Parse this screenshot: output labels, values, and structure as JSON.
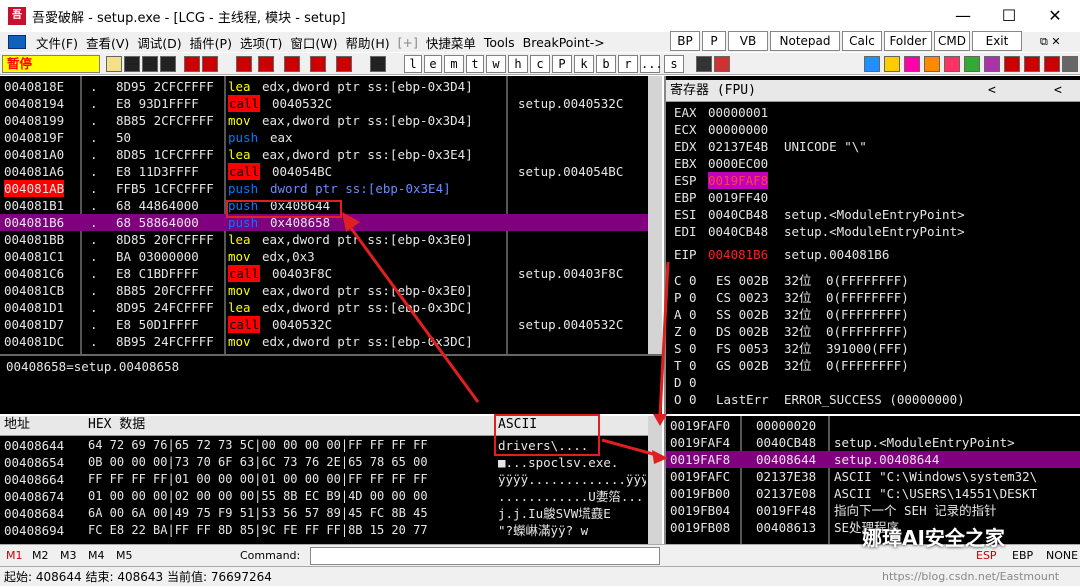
{
  "window": {
    "title": "吾愛破解 - setup.exe - [LCG - 主线程, 模块 - setup]",
    "app_icon_text": "吾",
    "minimize": "—",
    "maximize": "☐",
    "close": "✕"
  },
  "menu": {
    "items": [
      "文件(F)",
      "查看(V)",
      "调试(D)",
      "插件(P)",
      "选项(T)",
      "窗口(W)",
      "帮助(H)",
      "[+]",
      "快捷菜单",
      "Tools",
      "BreakPoint->"
    ],
    "quick_buttons": [
      "BP",
      "P",
      "VB",
      "Notepad",
      "Calc",
      "Folder",
      "CMD",
      "Exit"
    ]
  },
  "toolbar": {
    "status": "暂停",
    "letters": [
      "l",
      "e",
      "m",
      "t",
      "w",
      "h",
      "c",
      "P",
      "k",
      "b",
      "r",
      "...",
      "s"
    ]
  },
  "disasm": {
    "rows": [
      {
        "addr": "0040818E",
        "dot": ".",
        "hex": "8D95 2CFCFFFF",
        "op": "lea",
        "args": "edx,dword ptr ss:[ebp-0x3D4]",
        "comment": ""
      },
      {
        "addr": "00408194",
        "dot": ".",
        "hex": "E8 93D1FFFF",
        "op": "call",
        "args": "0040532C",
        "comment": "setup.0040532C"
      },
      {
        "addr": "00408199",
        "dot": ".",
        "hex": "8B85 2CFCFFFF",
        "op": "mov",
        "args": "eax,dword ptr ss:[ebp-0x3D4]",
        "comment": ""
      },
      {
        "addr": "0040819F",
        "dot": ".",
        "hex": "50",
        "op": "push",
        "args": "eax",
        "comment": ""
      },
      {
        "addr": "004081A0",
        "dot": ".",
        "hex": "8D85 1CFCFFFF",
        "op": "lea",
        "args": "eax,dword ptr ss:[ebp-0x3E4]",
        "comment": ""
      },
      {
        "addr": "004081A6",
        "dot": ".",
        "hex": "E8 11D3FFFF",
        "op": "call",
        "args": "004054BC",
        "comment": "setup.004054BC"
      },
      {
        "addr": "004081AB",
        "dot": ".",
        "hex": "FFB5 1CFCFFFF",
        "op": "push",
        "args": "dword ptr ss:[ebp-0x3E4]",
        "comment": ""
      },
      {
        "addr": "004081B1",
        "dot": ".",
        "hex": "68 44864000",
        "op": "push",
        "args": "0x408644",
        "comment": ""
      },
      {
        "addr": "004081B6",
        "dot": ".",
        "hex": "68 58864000",
        "op": "push",
        "args": "0x408658",
        "comment": ""
      },
      {
        "addr": "004081BB",
        "dot": ".",
        "hex": "8D85 20FCFFFF",
        "op": "lea",
        "args": "eax,dword ptr ss:[ebp-0x3E0]",
        "comment": ""
      },
      {
        "addr": "004081C1",
        "dot": ".",
        "hex": "BA 03000000",
        "op": "mov",
        "args": "edx,0x3",
        "comment": ""
      },
      {
        "addr": "004081C6",
        "dot": ".",
        "hex": "E8 C1BDFFFF",
        "op": "call",
        "args": "00403F8C",
        "comment": "setup.00403F8C"
      },
      {
        "addr": "004081CB",
        "dot": ".",
        "hex": "8B85 20FCFFFF",
        "op": "mov",
        "args": "eax,dword ptr ss:[ebp-0x3E0]",
        "comment": ""
      },
      {
        "addr": "004081D1",
        "dot": ".",
        "hex": "8D95 24FCFFFF",
        "op": "lea",
        "args": "edx,dword ptr ss:[ebp-0x3DC]",
        "comment": ""
      },
      {
        "addr": "004081D7",
        "dot": ".",
        "hex": "E8 50D1FFFF",
        "op": "call",
        "args": "0040532C",
        "comment": "setup.0040532C"
      },
      {
        "addr": "004081DC",
        "dot": ".",
        "hex": "8B95 24FCFFFF",
        "op": "mov",
        "args": "edx,dword ptr ss:[ebp-0x3DC]",
        "comment": ""
      }
    ],
    "info_line": "00408658=setup.00408658"
  },
  "registers": {
    "header": "寄存器 (FPU)",
    "general": [
      {
        "name": "EAX",
        "value": "00000001",
        "note": ""
      },
      {
        "name": "ECX",
        "value": "00000000",
        "note": ""
      },
      {
        "name": "EDX",
        "value": "02137E4B",
        "note": "UNICODE \"\\\""
      },
      {
        "name": "EBX",
        "value": "0000EC00",
        "note": ""
      },
      {
        "name": "ESP",
        "value": "0019FAF8",
        "note": ""
      },
      {
        "name": "EBP",
        "value": "0019FF40",
        "note": ""
      },
      {
        "name": "ESI",
        "value": "0040CB48",
        "note": "setup.<ModuleEntryPoint>"
      },
      {
        "name": "EDI",
        "value": "0040CB48",
        "note": "setup.<ModuleEntryPoint>"
      }
    ],
    "eip": {
      "name": "EIP",
      "value": "004081B6",
      "note": "setup.004081B6"
    },
    "segments": [
      {
        "flag": "C 0",
        "seg": "ES 002B",
        "bits": "32位",
        "limit": "0(FFFFFFFF)"
      },
      {
        "flag": "P 0",
        "seg": "CS 0023",
        "bits": "32位",
        "limit": "0(FFFFFFFF)"
      },
      {
        "flag": "A 0",
        "seg": "SS 002B",
        "bits": "32位",
        "limit": "0(FFFFFFFF)"
      },
      {
        "flag": "Z 0",
        "seg": "DS 002B",
        "bits": "32位",
        "limit": "0(FFFFFFFF)"
      },
      {
        "flag": "S 0",
        "seg": "FS 0053",
        "bits": "32位",
        "limit": "391000(FFF)"
      },
      {
        "flag": "T 0",
        "seg": "GS 002B",
        "bits": "32位",
        "limit": "0(FFFFFFFF)"
      },
      {
        "flag": "D 0",
        "seg": "",
        "bits": "",
        "limit": ""
      },
      {
        "flag": "O 0",
        "seg": "LastErr",
        "bits": "",
        "limit": "ERROR_SUCCESS (00000000)"
      }
    ]
  },
  "dump": {
    "col_addr": "地址",
    "col_hex": "HEX 数据",
    "col_ascii": "ASCII",
    "rows": [
      {
        "addr": "00408644",
        "hex": "64 72 69 76|65 72 73 5C|00 00 00 00|FF FF FF FF",
        "ascii": "drivers\\...."
      },
      {
        "addr": "00408654",
        "hex": "0B 00 00 00|73 70 6F 63|6C 73 76 2E|65 78 65 00",
        "ascii": "■...spoclsv.exe."
      },
      {
        "addr": "00408664",
        "hex": "FF FF FF FF|01 00 00 00|01 00 00 00|FF FF FF FF",
        "ascii": "ÿÿÿÿ.............ÿÿÿÿ"
      },
      {
        "addr": "00408674",
        "hex": "01 00 00 00|02 00 00 00|55 8B EC B9|4D 00 00 00",
        "ascii": "............U嬱箈..."
      },
      {
        "addr": "00408684",
        "hex": "6A 00 6A 00|49 75 F9 51|53 56 57 89|45 FC 8B 45",
        "ascii": "j.j.Iu鵔SVW塃鼖E"
      },
      {
        "addr": "00408694",
        "hex": "FC E8 22 BA|FF FF 8D 85|9C FE FF FF|8B 15 20 77",
        "ascii": "\"?蠑崊滿ÿÿ? w"
      }
    ]
  },
  "stack": {
    "rows": [
      {
        "addr": "0019FAF0",
        "value": "00000020",
        "note": ""
      },
      {
        "addr": "0019FAF4",
        "value": "0040CB48",
        "note": "setup.<ModuleEntryPoint>"
      },
      {
        "addr": "0019FAF8",
        "value": "00408644",
        "note": "setup.00408644"
      },
      {
        "addr": "0019FAFC",
        "value": "02137E38",
        "note": "ASCII \"C:\\Windows\\system32\\"
      },
      {
        "addr": "0019FB00",
        "value": "02137E08",
        "note": "ASCII \"C:\\USERS\\14551\\DESKT"
      },
      {
        "addr": "0019FB04",
        "value": "0019FF48",
        "note": "指向下一个 SEH 记录的指针"
      },
      {
        "addr": "0019FB08",
        "value": "00408613",
        "note": "SE处理程序"
      }
    ]
  },
  "cmdbar": {
    "tabs": [
      "M1",
      "M2",
      "M3",
      "M4",
      "M5"
    ],
    "command_label": "Command:",
    "regs": [
      "ESP",
      "EBP",
      "NONE"
    ]
  },
  "status": {
    "text": "起始: 408644 结束: 408643 当前值: 76697264",
    "watermark": "https://blog.csdn.net/Eastmount",
    "brand": "娜璋AI安全之家"
  },
  "colors": {
    "highlight": "#800080",
    "bp_red": "#ff0000",
    "annotation": "#e02020"
  }
}
